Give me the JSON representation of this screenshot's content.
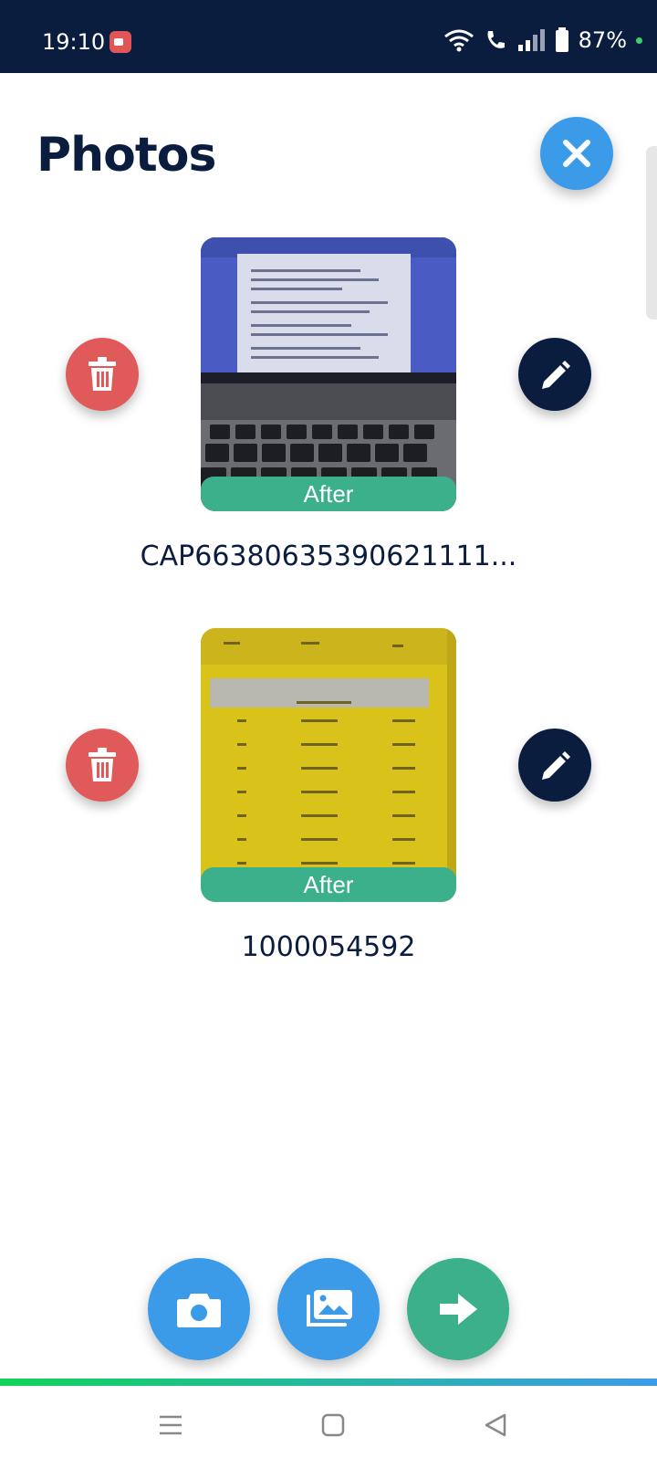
{
  "status": {
    "time": "19:10",
    "battery": "87%"
  },
  "page": {
    "title": "Photos"
  },
  "photos": [
    {
      "label": "After",
      "filename": "CAP66380635390621111..."
    },
    {
      "label": "After",
      "filename": "1000054592"
    }
  ],
  "colors": {
    "navy": "#0b1d3f",
    "blue": "#3c9be8",
    "green": "#3bb08a",
    "red": "#e05a5a"
  },
  "icons": {
    "close": "close-icon",
    "delete": "trash-icon",
    "edit": "pencil-icon",
    "camera": "camera-icon",
    "gallery": "gallery-icon",
    "next": "arrow-right-icon"
  }
}
